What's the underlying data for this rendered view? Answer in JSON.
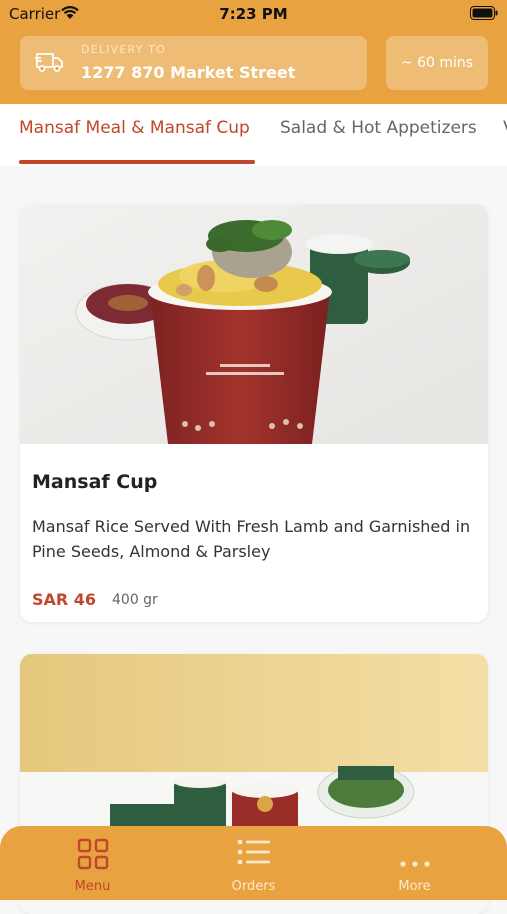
{
  "status_bar": {
    "carrier": "Carrier",
    "time": "7:23 PM"
  },
  "header": {
    "delivery_label": "DELIVERY TO",
    "delivery_address": "1277 870 Market Street",
    "eta": "~ 60 mins"
  },
  "categories": [
    {
      "label": "Mansaf Meal & Mansaf Cup",
      "active": true
    },
    {
      "label": "Salad & Hot Appetizers",
      "active": false
    },
    {
      "label": "V",
      "active": false
    }
  ],
  "products": [
    {
      "name": "Mansaf Cup",
      "description": "Mansaf Rice Served With Fresh Lamb and Garnished in Pine Seeds, Almond & Parsley",
      "price": "SAR 46",
      "weight": "400 gr"
    }
  ],
  "tabbar": {
    "items": [
      {
        "label": "Menu",
        "icon": "grid-icon",
        "active": true
      },
      {
        "label": "Orders",
        "icon": "list-icon",
        "active": false
      },
      {
        "label": "More",
        "icon": "more-dots-icon",
        "active": false
      }
    ]
  },
  "colors": {
    "brand": "#e8a23f",
    "accent": "#c0462c",
    "cup_red": "#9b2d28",
    "cup_green": "#2f5d3f"
  }
}
